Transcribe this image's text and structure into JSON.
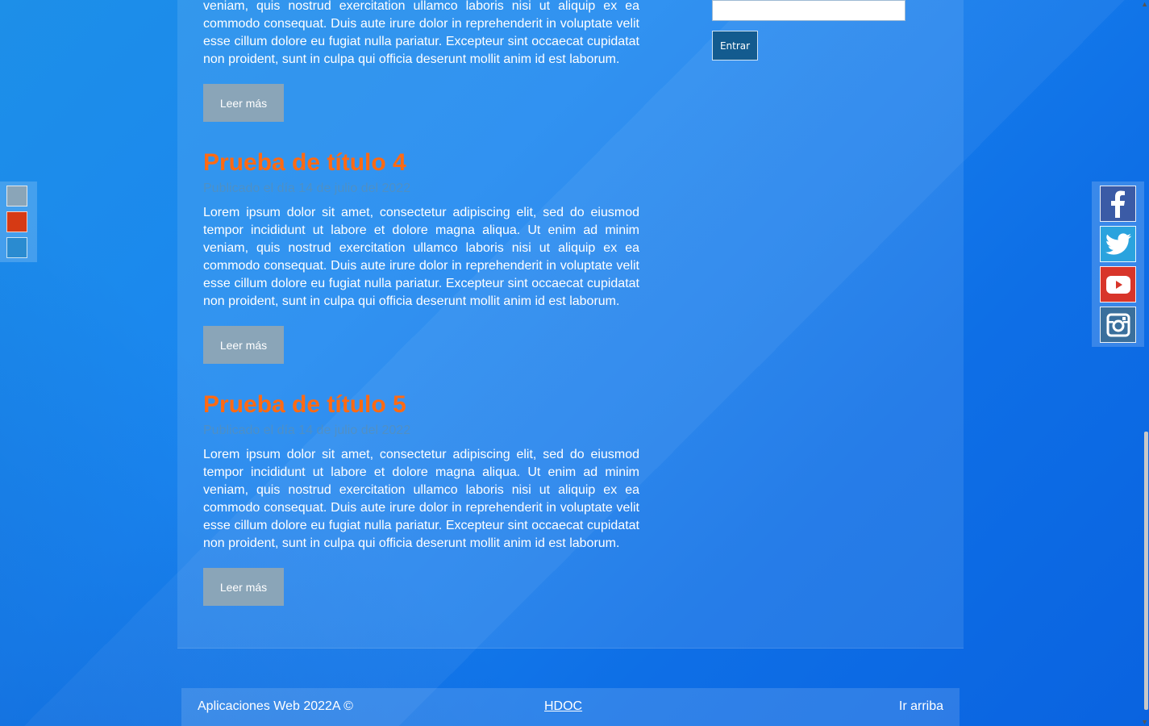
{
  "posts": [
    {
      "title": "",
      "date": "",
      "body": "veniam, quis nostrud exercitation ullamco laboris nisi ut aliquip ex ea commodo consequat. Duis aute irure dolor in reprehenderit in voluptate velit esse cillum dolore eu fugiat nulla pariatur. Excepteur sint occaecat cupidatat non proident, sunt in culpa qui officia deserunt mollit anim id est laborum.",
      "button": "Leer más"
    },
    {
      "title": "Prueba de título 4",
      "date": "Publicado el día 14 de julio del 2022",
      "body": "Lorem ipsum dolor sit amet, consectetur adipiscing elit, sed do eiusmod tempor incididunt ut labore et dolore magna aliqua. Ut enim ad minim veniam, quis nostrud exercitation ullamco laboris nisi ut aliquip ex ea commodo consequat. Duis aute irure dolor in reprehenderit in voluptate velit esse cillum dolore eu fugiat nulla pariatur. Excepteur sint occaecat cupidatat non proident, sunt in culpa qui officia deserunt mollit anim id est laborum.",
      "button": "Leer más"
    },
    {
      "title": "Prueba de título 5",
      "date": "Publicado el día 14 de julio del 2022",
      "body": "Lorem ipsum dolor sit amet, consectetur adipiscing elit, sed do eiusmod tempor incididunt ut labore et dolore magna aliqua. Ut enim ad minim veniam, quis nostrud exercitation ullamco laboris nisi ut aliquip ex ea commodo consequat. Duis aute irure dolor in reprehenderit in voluptate velit esse cillum dolore eu fugiat nulla pariatur. Excepteur sint occaecat cupidatat non proident, sunt in culpa qui officia deserunt mollit anim id est laborum.",
      "button": "Leer más"
    }
  ],
  "sidebar": {
    "login_input_value": "",
    "login_button": "Entrar"
  },
  "theme_swatches": [
    {
      "name": "gray",
      "color": "#8aa5b8"
    },
    {
      "name": "red",
      "color": "#d63a14"
    },
    {
      "name": "blue",
      "color": "#2a8bd0"
    }
  ],
  "social": [
    {
      "icon": "facebook-icon",
      "glyph": "f",
      "color": "#3b5ba6"
    },
    {
      "icon": "twitter-icon",
      "glyph": "🐦",
      "color": "#2aa3de"
    },
    {
      "icon": "youtube-icon",
      "glyph": "▶",
      "color": "#d8352a"
    },
    {
      "icon": "instagram-icon",
      "glyph": "◎",
      "color": "#3a6f9c"
    }
  ],
  "footer": {
    "left": "Aplicaciones Web 2022A ©",
    "middle": "HDOC",
    "right": "Ir arriba"
  },
  "colors": {
    "accent": "#ff6a13",
    "button": "#8aa5b8",
    "login_button": "#135b8f"
  }
}
